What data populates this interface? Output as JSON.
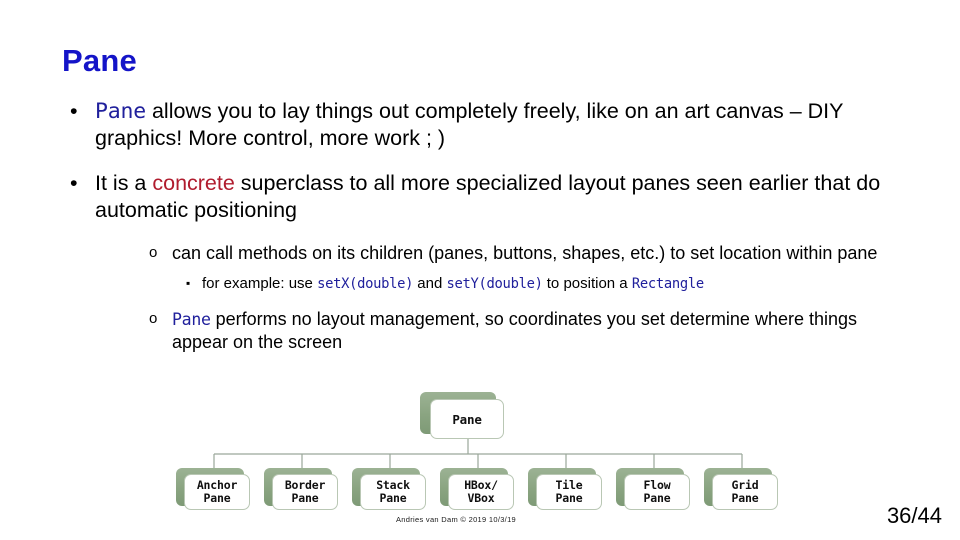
{
  "slide": {
    "title": "Pane",
    "page_number": "36/44",
    "credit": "Andries van Dam © 2019 10/3/19",
    "accent_title_color": "#1414c8",
    "code_color": "#20209c",
    "highlight_color": "#b01c2e",
    "node_shadow_color": "#8aa481"
  },
  "bullets": {
    "level1": [
      {
        "marker": "•",
        "parts": [
          {
            "text": "Pane",
            "style": "code"
          },
          {
            "text": " allows you to lay things out completely freely, like on an art canvas – DIY graphics! More control, more work ; )",
            "style": "plain"
          }
        ]
      },
      {
        "marker": "•",
        "parts": [
          {
            "text": "It is a ",
            "style": "plain"
          },
          {
            "text": "concrete",
            "style": "red"
          },
          {
            "text": " superclass to all more specialized layout panes seen earlier that do automatic positioning",
            "style": "plain"
          }
        ]
      }
    ],
    "level2_first": {
      "marker": "o",
      "parts": [
        {
          "text": "can call methods on its children (panes, buttons, shapes, etc.) to set location within pane",
          "style": "plain"
        }
      ]
    },
    "level3": {
      "marker": "▪",
      "parts": [
        {
          "text": "for example: use ",
          "style": "plain"
        },
        {
          "text": "setX(double)",
          "style": "code"
        },
        {
          "text": " and ",
          "style": "plain"
        },
        {
          "text": "setY(double)",
          "style": "code"
        },
        {
          "text": " to position a ",
          "style": "plain"
        },
        {
          "text": "Rectangle",
          "style": "code"
        }
      ]
    },
    "level2_second": {
      "marker": "o",
      "parts": [
        {
          "text": "Pane",
          "style": "code"
        },
        {
          "text": " performs no layout management, so coordinates you set determine where things appear on the screen",
          "style": "plain"
        }
      ]
    }
  },
  "diagram": {
    "root": {
      "label": "Pane"
    },
    "children": [
      {
        "label": "Anchor\nPane"
      },
      {
        "label": "Border\nPane"
      },
      {
        "label": "Stack\nPane"
      },
      {
        "label": "HBox/\nVBox"
      },
      {
        "label": "Tile\nPane"
      },
      {
        "label": "Flow\nPane"
      },
      {
        "label": "Grid\nPane"
      }
    ]
  }
}
